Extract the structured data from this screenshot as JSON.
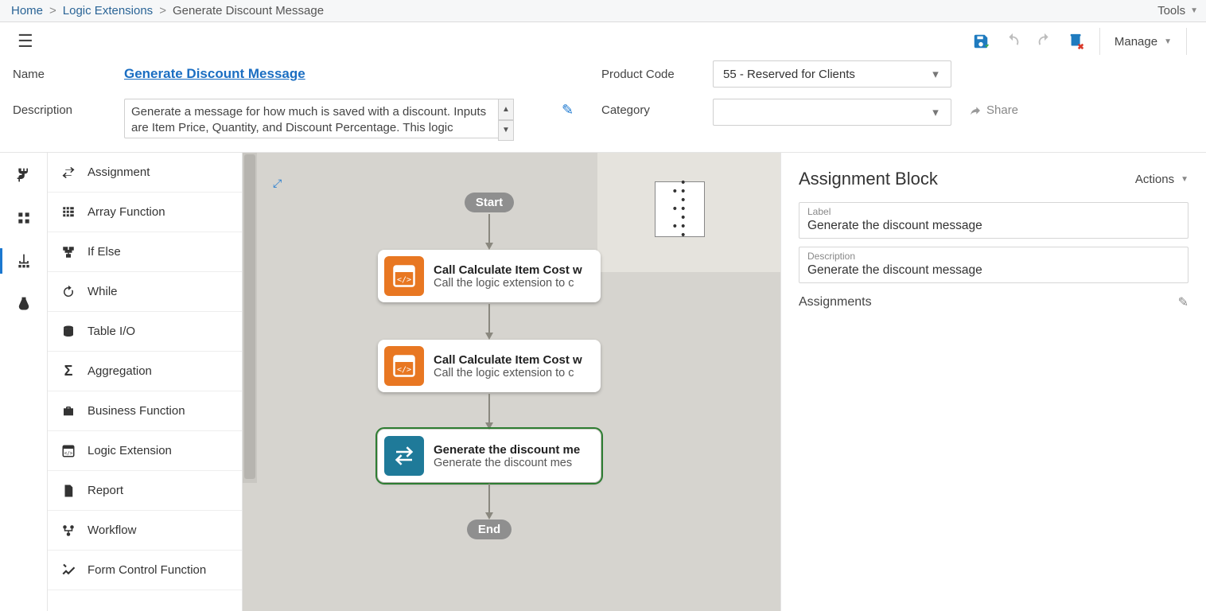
{
  "topbar": {
    "home": "Home",
    "logic_extensions": "Logic Extensions",
    "current": "Generate Discount Message",
    "tools": "Tools"
  },
  "toolbar": {
    "manage": "Manage"
  },
  "form": {
    "name_label": "Name",
    "name_value": "Generate Discount Message",
    "description_label": "Description",
    "description_value": "Generate a message for how much is saved with a discount. Inputs are Item Price, Quantity, and Discount Percentage. This logic extension calls \"Calculate Item Cost with Discount\"",
    "product_code_label": "Product Code",
    "product_code_value": "55 - Reserved for Clients",
    "category_label": "Category",
    "category_value": "",
    "share": "Share"
  },
  "palette": {
    "items": [
      {
        "icon": "swap",
        "label": "Assignment"
      },
      {
        "icon": "grid",
        "label": "Array Function"
      },
      {
        "icon": "branch",
        "label": "If Else"
      },
      {
        "icon": "loop",
        "label": "While"
      },
      {
        "icon": "db",
        "label": "Table I/O"
      },
      {
        "icon": "sigma",
        "label": "Aggregation"
      },
      {
        "icon": "briefcase",
        "label": "Business Function"
      },
      {
        "icon": "lex",
        "label": "Logic Extension"
      },
      {
        "icon": "doc",
        "label": "Report"
      },
      {
        "icon": "flow",
        "label": "Workflow"
      },
      {
        "icon": "tools",
        "label": "Form Control Function"
      }
    ]
  },
  "flow": {
    "start": "Start",
    "end": "End",
    "nodes": [
      {
        "kind": "lex",
        "title": "Call Calculate Item Cost w",
        "sub": "Call the logic extension to c",
        "selected": false
      },
      {
        "kind": "lex",
        "title": "Call Calculate Item Cost w",
        "sub": "Call the logic extension to c",
        "selected": false
      },
      {
        "kind": "assign",
        "title": "Generate the discount me",
        "sub": "Generate the discount mes",
        "selected": true
      }
    ]
  },
  "props": {
    "title": "Assignment Block",
    "actions": "Actions",
    "label_caption": "Label",
    "label_value": "Generate the discount message",
    "desc_caption": "Description",
    "desc_value": "Generate the discount message",
    "assignments": "Assignments"
  }
}
